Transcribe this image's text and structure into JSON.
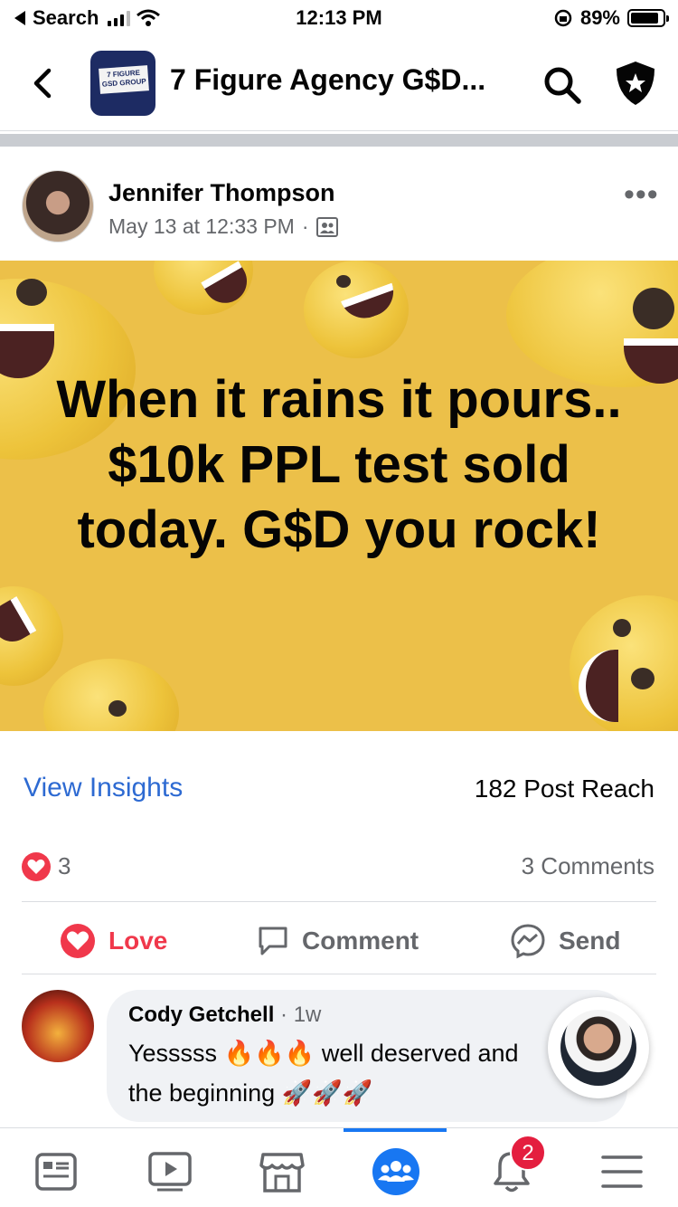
{
  "status_bar": {
    "back_label": "Search",
    "time": "12:13 PM",
    "battery": "89%",
    "battery_level": 0.89,
    "icons": [
      "signal-icon",
      "wifi-icon",
      "rotation-lock-icon",
      "battery-icon"
    ]
  },
  "header": {
    "group_thumb_text": "7 FIGURE GSD GROUP",
    "group_name": "7 Figure Agency G$D...",
    "icons": [
      "back-chevron-icon",
      "search-icon",
      "shield-star-icon"
    ]
  },
  "post": {
    "author": "Jennifer Thompson",
    "timestamp": "May 13 at 12:33 PM",
    "separator": "·",
    "audience_icon": "members-group-icon",
    "image_text": "When it rains it pours.. $10k PPL test sold today. G$D you rock!",
    "more_icon": "more-dots-icon"
  },
  "insights": {
    "link": "View Insights",
    "reach": "182 Post Reach"
  },
  "reactions": {
    "count": "3",
    "comments": "3 Comments"
  },
  "actions": {
    "love": "Love",
    "comment": "Comment",
    "send": "Send"
  },
  "comment": {
    "author": "Cody Getchell",
    "time": "· 1w",
    "line1": "Yesssss 🔥🔥🔥 well deserved and",
    "line2": "the beginning 🚀🚀🚀"
  },
  "bottom_nav": {
    "items": [
      "news-feed-icon",
      "watch-icon",
      "marketplace-icon",
      "groups-icon",
      "notifications-icon",
      "menu-icon"
    ],
    "notification_badge": "2",
    "active": "groups-icon"
  },
  "colors": {
    "accent": "#1877f2",
    "love": "#f0384b",
    "image_bg": "#ecc049"
  }
}
